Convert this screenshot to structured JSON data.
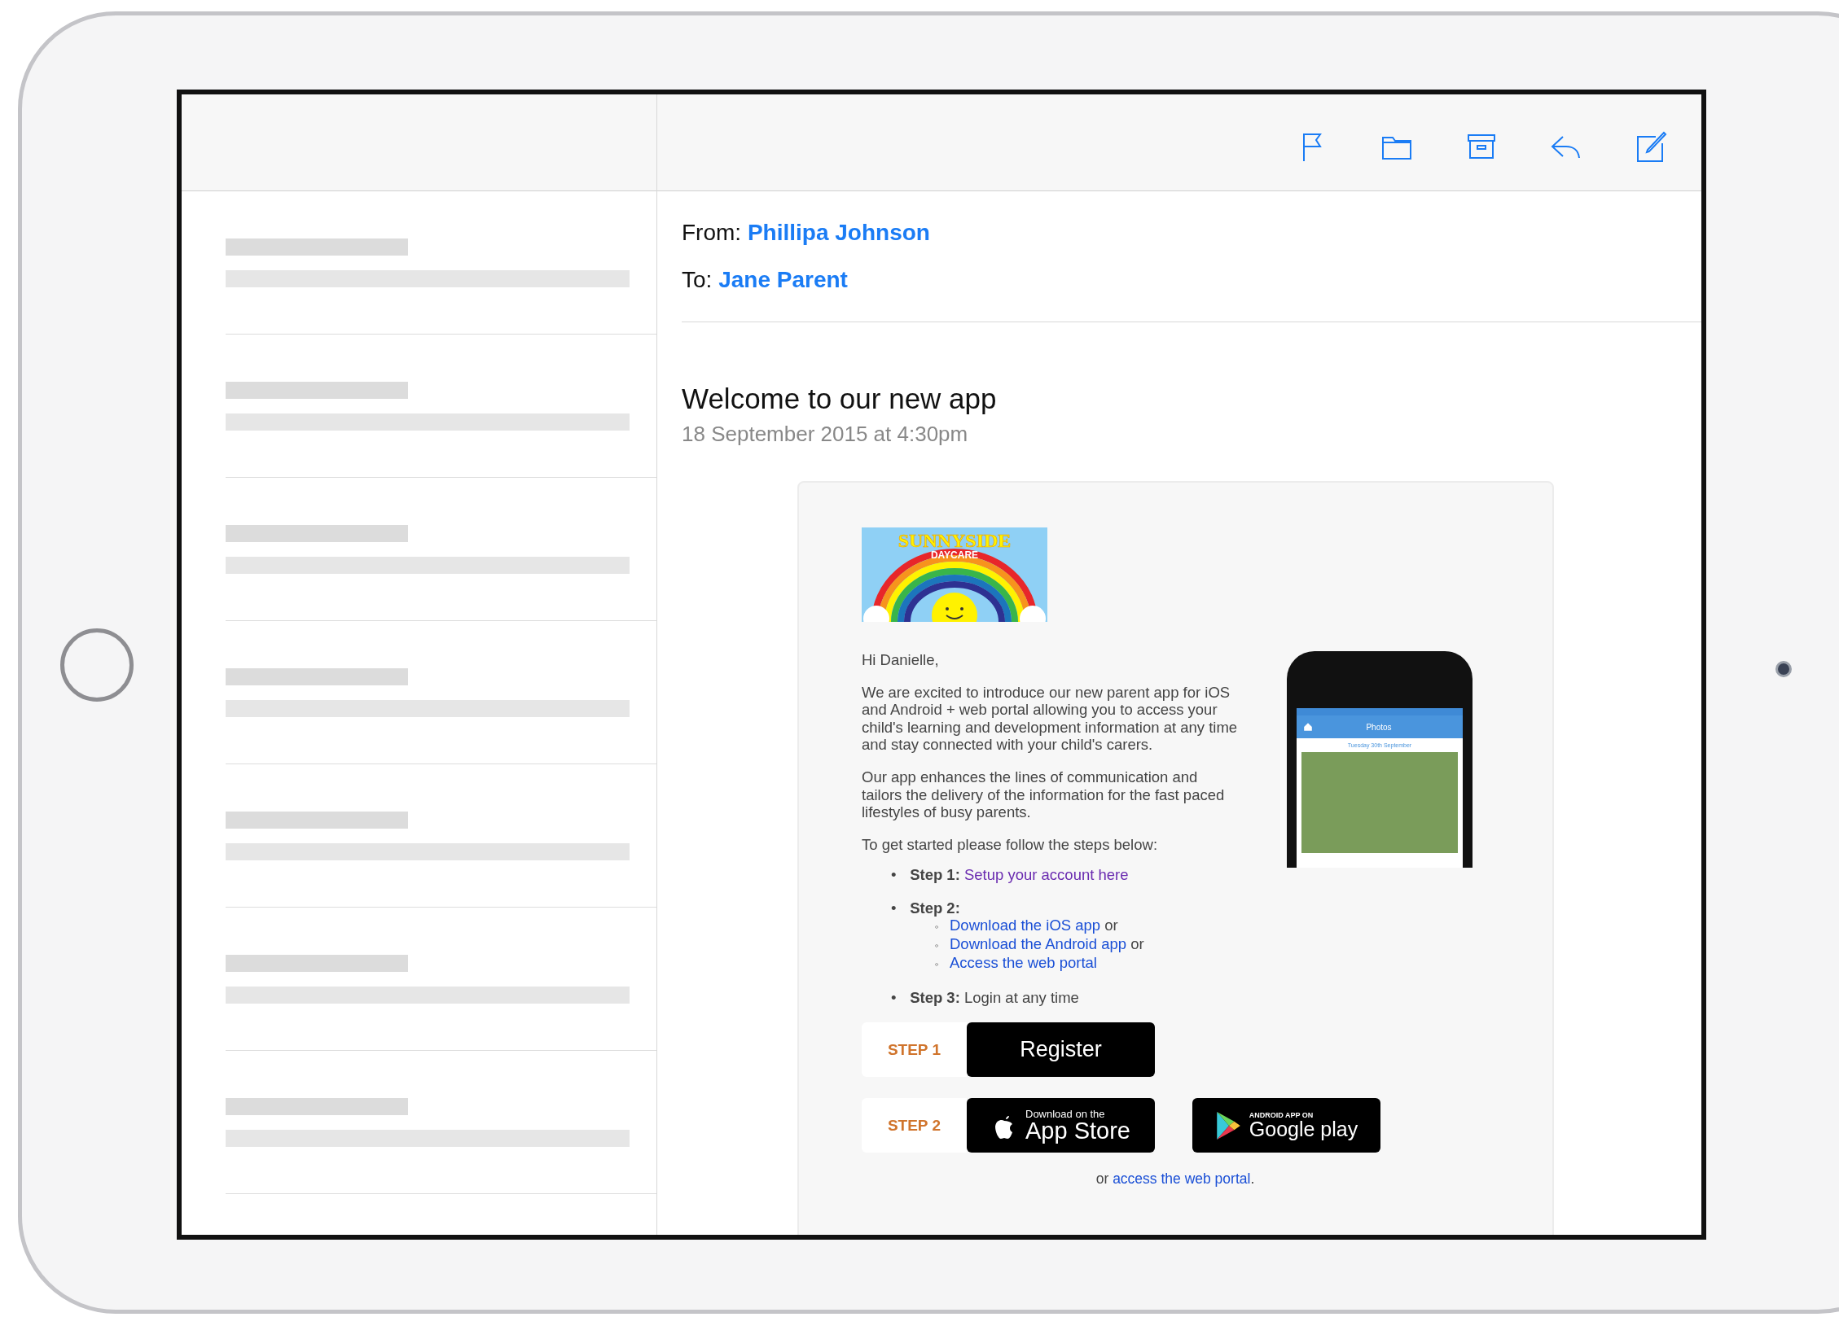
{
  "message": {
    "from_label": "From:",
    "from": "Phillipa Johnson",
    "to_label": "To:",
    "to": "Jane Parent",
    "subject": "Welcome to our new app",
    "date": "18 September 2015 at 4:30pm"
  },
  "email_body": {
    "logo": {
      "title": "SUNNYSIDE",
      "subtitle": "DAYCARE"
    },
    "greeting": "Hi Danielle,",
    "paragraphs": [
      "We are excited to introduce our new parent app for iOS and Android + web portal allowing you to access your child's learning and development information at any time and stay connected with your child's carers.",
      "Our app enhances the lines of communication and tailors the delivery of the information for the fast paced lifestyles of busy parents.",
      "To get started please follow the steps below:"
    ],
    "phone_preview": {
      "title": "Photos",
      "date": "Tuesday 30th September"
    },
    "steps": [
      {
        "marker": "•",
        "label": "Step 1:",
        "link": "Setup your account here",
        "visited": true
      },
      {
        "marker": "•",
        "label": "Step 2:",
        "options": [
          {
            "marker": "◦",
            "link": "Download the iOS app",
            "suffix": "or"
          },
          {
            "marker": "◦",
            "link": "Download the Android app",
            "suffix": "or"
          },
          {
            "marker": "◦",
            "link": "Access the web portal"
          }
        ]
      },
      {
        "marker": "•",
        "label": "Step 3:",
        "text": "Login at any time"
      }
    ],
    "actions": [
      {
        "step": "STEP 1",
        "buttons": [
          {
            "kind": "register",
            "text": "Register"
          }
        ]
      },
      {
        "step": "STEP 2",
        "buttons": [
          {
            "kind": "app_store",
            "small": "Download on the",
            "large": "App Store"
          },
          {
            "kind": "google_play",
            "small": "ANDROID APP ON",
            "large": "Google play"
          }
        ]
      }
    ],
    "portal": {
      "prefix": "or",
      "link": "access the web portal",
      "suffix": "."
    }
  }
}
